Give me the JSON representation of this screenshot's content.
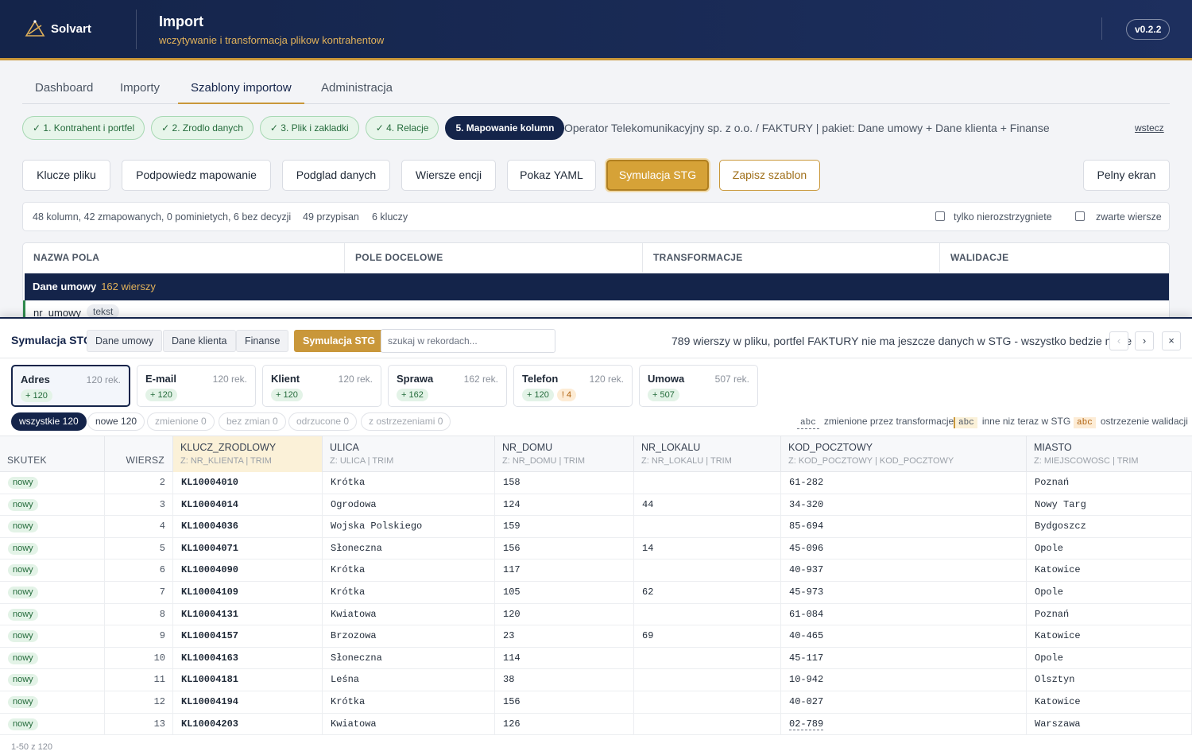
{
  "header": {
    "brand": "Solvart",
    "title": "Import",
    "subtitle": "wczytywanie i transformacja plikow kontrahentow",
    "version": "v0.2.2"
  },
  "nav": {
    "tabs": [
      "Dashboard",
      "Importy",
      "Szablony importow",
      "Administracja"
    ],
    "active": "Szablony importow"
  },
  "steps": {
    "items": [
      "✓ 1. Kontrahent i portfel",
      "✓ 2. Zrodlo danych",
      "✓ 3. Plik i zakladki",
      "✓ 4. Relacje",
      "5. Mapowanie kolumn"
    ],
    "info": "Operator Telekomunikacyjny sp. z o.o. / FAKTURY | pakiet: Dane umowy + Dane klienta + Finanse",
    "back": "wstecz"
  },
  "toolbar": {
    "buttons": [
      "Klucze pliku",
      "Podpowiedz mapowanie",
      "Podglad danych",
      "Wiersze encji",
      "Pokaz YAML",
      "Symulacja STG",
      "Zapisz szablon",
      "Pelny ekran"
    ]
  },
  "summary": {
    "columns": "48 kolumn, 42 zmapowanych, 0 pominietych, 6 bez decyzji",
    "assigned": "49 przypisan",
    "keys": "6 kluczy",
    "only_unresolved": "tylko nierozstrzygniete",
    "compact_rows": "zwarte wiersze"
  },
  "mapping": {
    "headers": [
      "NAZWA POLA",
      "POLE DOCELOWE",
      "TRANSFORMACJE",
      "WALIDACJE"
    ],
    "group": "Dane umowy",
    "group_count": "162 wierszy",
    "first_field": "nr_umowy",
    "first_type": "tekst"
  },
  "simulation": {
    "title": "Symulacja STG",
    "tabs": [
      "Dane umowy",
      "Dane klienta",
      "Finanse",
      "Symulacja STG"
    ],
    "search_placeholder": "szukaj w rekordach...",
    "info": "789 wierszy w pliku, portfel FAKTURY nie ma jeszcze danych w STG - wszystko bedzie nowe",
    "prev": "‹",
    "next": "›",
    "close": "×",
    "entities": [
      {
        "name": "Adres",
        "count": "120 rek.",
        "new": "+ 120",
        "warn": ""
      },
      {
        "name": "E-mail",
        "count": "120 rek.",
        "new": "+ 120",
        "warn": ""
      },
      {
        "name": "Klient",
        "count": "120 rek.",
        "new": "+ 120",
        "warn": ""
      },
      {
        "name": "Sprawa",
        "count": "162 rek.",
        "new": "+ 162",
        "warn": ""
      },
      {
        "name": "Telefon",
        "count": "120 rek.",
        "new": "+ 120",
        "warn": "! 4"
      },
      {
        "name": "Umowa",
        "count": "507 rek.",
        "new": "+ 507",
        "warn": ""
      }
    ],
    "filters": [
      "wszystkie 120",
      "nowe 120",
      "zmienione 0",
      "bez zmian 0",
      "odrzucone 0",
      "z ostrzezeniami 0"
    ],
    "legend": {
      "abc": "abc",
      "changed": "zmienione przez transformacje",
      "different": "inne niz teraz w STG",
      "warning": "ostrzezenie walidacji"
    },
    "columns": [
      {
        "title": "SKUTEK",
        "sub": ""
      },
      {
        "title": "WIERSZ",
        "sub": ""
      },
      {
        "title": "KLUCZ_ZRODLOWY",
        "sub": "Z: NR_KLIENTA | TRIM"
      },
      {
        "title": "ULICA",
        "sub": "Z: ULICA | TRIM"
      },
      {
        "title": "NR_DOMU",
        "sub": "Z: NR_DOMU | TRIM"
      },
      {
        "title": "NR_LOKALU",
        "sub": "Z: NR_LOKALU | TRIM"
      },
      {
        "title": "KOD_POCZTOWY",
        "sub": "Z: KOD_POCZTOWY | KOD_POCZTOWY"
      },
      {
        "title": "MIASTO",
        "sub": "Z: MIEJSCOWOSC | TRIM"
      }
    ],
    "rows": [
      {
        "effect": "nowy",
        "row": "2",
        "key": "KL10004010",
        "street": "Krótka",
        "house": "158",
        "flat": "",
        "zip": "61-282",
        "city": "Poznań"
      },
      {
        "effect": "nowy",
        "row": "3",
        "key": "KL10004014",
        "street": "Ogrodowa",
        "house": "124",
        "flat": "44",
        "zip": "34-320",
        "city": "Nowy Targ"
      },
      {
        "effect": "nowy",
        "row": "4",
        "key": "KL10004036",
        "street": "Wojska Polskiego",
        "house": "159",
        "flat": "",
        "zip": "85-694",
        "city": "Bydgoszcz"
      },
      {
        "effect": "nowy",
        "row": "5",
        "key": "KL10004071",
        "street": "Słoneczna",
        "house": "156",
        "flat": "14",
        "zip": "45-096",
        "city": "Opole"
      },
      {
        "effect": "nowy",
        "row": "6",
        "key": "KL10004090",
        "street": "Krótka",
        "house": "117",
        "flat": "",
        "zip": "40-937",
        "city": "Katowice"
      },
      {
        "effect": "nowy",
        "row": "7",
        "key": "KL10004109",
        "street": "Krótka",
        "house": "105",
        "flat": "62",
        "zip": "45-973",
        "city": "Opole"
      },
      {
        "effect": "nowy",
        "row": "8",
        "key": "KL10004131",
        "street": "Kwiatowa",
        "house": "120",
        "flat": "",
        "zip": "61-084",
        "city": "Poznań"
      },
      {
        "effect": "nowy",
        "row": "9",
        "key": "KL10004157",
        "street": "Brzozowa",
        "house": "23",
        "flat": "69",
        "zip": "40-465",
        "city": "Katowice"
      },
      {
        "effect": "nowy",
        "row": "10",
        "key": "KL10004163",
        "street": "Słoneczna",
        "house": "114",
        "flat": "",
        "zip": "45-117",
        "city": "Opole"
      },
      {
        "effect": "nowy",
        "row": "11",
        "key": "KL10004181",
        "street": "Leśna",
        "house": "38",
        "flat": "",
        "zip": "10-942",
        "city": "Olsztyn"
      },
      {
        "effect": "nowy",
        "row": "12",
        "key": "KL10004194",
        "street": "Krótka",
        "house": "156",
        "flat": "",
        "zip": "40-027",
        "city": "Katowice"
      },
      {
        "effect": "nowy",
        "row": "13",
        "key": "KL10004203",
        "street": "Kwiatowa",
        "house": "126",
        "flat": "",
        "zip": "02-789",
        "city": "Warszawa"
      }
    ],
    "changed_zip_row": 11,
    "pager": "1-50 z 120"
  },
  "colors": {
    "navy": "#14244a",
    "gold": "#c9973a",
    "new_green": "#246b3b"
  }
}
